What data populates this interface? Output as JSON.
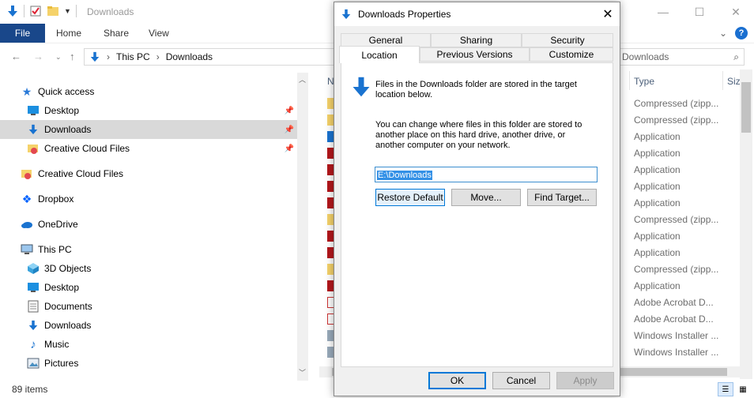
{
  "explorer": {
    "title": "Downloads",
    "window_controls": {
      "minimize": "—",
      "maximize": "☐",
      "close": "✕"
    },
    "ribbon": {
      "file_tab": "File",
      "tabs": [
        "Home",
        "Share",
        "View"
      ],
      "collapse": "⌄",
      "help": "?"
    },
    "address": {
      "segments": [
        "This PC",
        "Downloads"
      ],
      "separator": "›"
    },
    "search": {
      "placeholder": "Downloads"
    },
    "nav_pane": [
      {
        "label": "Quick access",
        "icon": "star-icon"
      },
      {
        "label": "Desktop",
        "icon": "desktop-icon",
        "pinned": true
      },
      {
        "label": "Downloads",
        "icon": "download-arrow-icon",
        "pinned": true,
        "selected": true
      },
      {
        "label": "Creative Cloud Files",
        "icon": "creative-cloud-icon",
        "pinned": true
      },
      {
        "label": "Creative Cloud Files",
        "icon": "creative-cloud-icon"
      },
      {
        "label": "Dropbox",
        "icon": "dropbox-icon"
      },
      {
        "label": "OneDrive",
        "icon": "cloud-icon"
      },
      {
        "label": "This PC",
        "icon": "computer-icon"
      },
      {
        "label": "3D Objects",
        "icon": "cube-icon"
      },
      {
        "label": "Desktop",
        "icon": "desktop-icon"
      },
      {
        "label": "Documents",
        "icon": "document-icon"
      },
      {
        "label": "Downloads",
        "icon": "download-arrow-icon"
      },
      {
        "label": "Music",
        "icon": "music-icon"
      },
      {
        "label": "Pictures",
        "icon": "picture-icon"
      }
    ],
    "columns": {
      "name": "N",
      "type": "Type",
      "size": "Siz"
    },
    "types": [
      "Compressed (zipp...",
      "Compressed (zipp...",
      "Application",
      "Application",
      "Application",
      "Application",
      "Application",
      "Compressed (zipp...",
      "Application",
      "Application",
      "Compressed (zipp...",
      "Application",
      "Adobe Acrobat D...",
      "Adobe Acrobat D...",
      "Windows Installer ...",
      "Windows Installer ..."
    ],
    "status": {
      "count": "89 items"
    }
  },
  "dialog": {
    "title": "Downloads Properties",
    "tabs_row1": [
      "General",
      "Sharing",
      "Security"
    ],
    "tabs_row2": [
      "Location",
      "Previous Versions",
      "Customize"
    ],
    "active_tab": "Location",
    "text1": "Files in the Downloads folder are stored in the target location below.",
    "text2": "You can change where files in this folder are stored to another place on this hard drive, another drive, or another computer on your network.",
    "path_value": "E:\\Downloads",
    "buttons": {
      "restore": "Restore Default",
      "move": "Move...",
      "find": "Find Target...",
      "ok": "OK",
      "cancel": "Cancel",
      "apply": "Apply"
    }
  },
  "colors": {
    "file_tab": "#19478a",
    "accent": "#0078d7",
    "selection": "#3390e6",
    "type_text": "#6d6d6d"
  }
}
